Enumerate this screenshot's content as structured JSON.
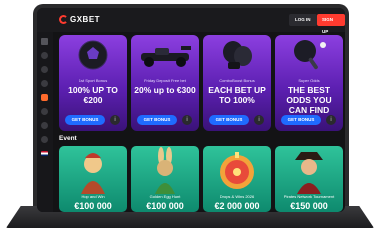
{
  "header": {
    "logo": "GXBET",
    "login_label": "LOG IN",
    "signup_label": "SIGN UP"
  },
  "colors": {
    "accent": "#ff3b2f",
    "cta": "#1f6bff",
    "promo_purple": "#6a28c8",
    "event_green": "#1aa882"
  },
  "promos": [
    {
      "subtitle": "1st Sport Bonus",
      "headline": "100% UP TO €200",
      "button": "GET BONUS",
      "icon": "football-icon"
    },
    {
      "subtitle": "Friday Deposit Free bet",
      "headline": "20% up to €300",
      "button": "GET BONUS",
      "icon": "race-car-icon"
    },
    {
      "subtitle": "ComboBoost Bonus",
      "headline": "EACH BET UP TO 100%",
      "button": "GET BONUS",
      "icon": "boxing-gloves-icon"
    },
    {
      "subtitle": "Super Odds",
      "headline": "THE BEST ODDS YOU CAN FIND",
      "button": "GET BONUS",
      "icon": "ping-pong-icon"
    }
  ],
  "event": {
    "title": "Event",
    "games": [
      {
        "name": "Hop and Win",
        "amount": "€100 000"
      },
      {
        "name": "Golden Egg Hunt",
        "amount": "€100 000"
      },
      {
        "name": "Drops & Wins 2026",
        "amount": "€2 000 000"
      },
      {
        "name": "Pirates Network Tournament",
        "amount": "€150 000"
      }
    ]
  },
  "sidebar": {
    "icons": [
      "menu-icon",
      "home-icon",
      "sports-icon",
      "live-icon",
      "casino-icon",
      "promo-icon",
      "games-icon",
      "chat-icon",
      "language-flag-icon"
    ]
  }
}
